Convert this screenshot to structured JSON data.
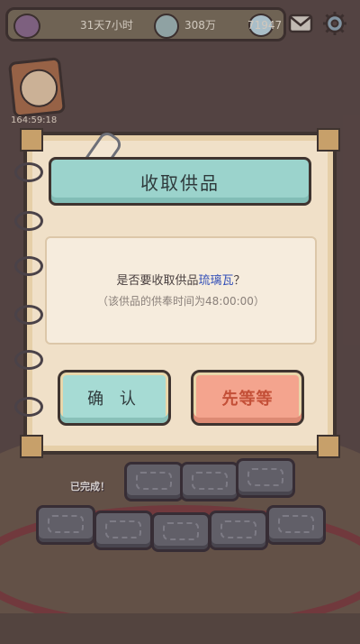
{
  "topbar": {
    "time_text": "31天7小时",
    "coins": "308万",
    "messages": "71947"
  },
  "cat_card": {
    "timer": "164:59:18"
  },
  "scene": {
    "done_label": "已完成！"
  },
  "dialog": {
    "title": "收取供品",
    "message_prefix": "是否要收取供品",
    "item_name": "琉璃瓦",
    "message_suffix": "？",
    "note": "（该供品的供奉时间为48:00:00）",
    "confirm_label": "确 认",
    "wait_label": "先等等"
  },
  "colors": {
    "title_bar": "#9bd3cc",
    "confirm_button": "#a6dbd4",
    "wait_button": "#f4a48e",
    "item_highlight": "#3450b8"
  }
}
